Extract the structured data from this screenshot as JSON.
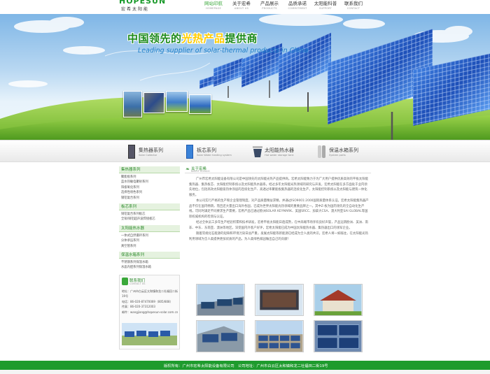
{
  "header": {
    "logo": {
      "brand": "HOPESUN",
      "cn": "宏希太阳能"
    },
    "nav": [
      {
        "cn": "网站印航",
        "en": "HOMEPAGE",
        "active": true
      },
      {
        "cn": "关于宏希",
        "en": "ABOUT US",
        "active": false
      },
      {
        "cn": "产品展示",
        "en": "PRODUCTS",
        "active": false
      },
      {
        "cn": "品质承诺",
        "en": "COMMITMENT",
        "active": false
      },
      {
        "cn": "太阳能科普",
        "en": "SUPPORT",
        "active": false
      },
      {
        "cn": "联系我们",
        "en": "CONTACT",
        "active": false
      }
    ]
  },
  "banner": {
    "slogan_cn_a": "中国领先的",
    "slogan_cn_b": "光热产品",
    "slogan_cn_c": "提供商",
    "slogan_en": "Leading supplier of solar-thermal products in China"
  },
  "categories": [
    {
      "cn": "集热器系列",
      "en": "Solar Collector"
    },
    {
      "cn": "板芯系列",
      "en": "Solar Water heating system"
    },
    {
      "cn": "太阳能热水器",
      "en": "Hot water storage tank"
    },
    {
      "cn": "保温水箱系列",
      "en": "System parts"
    }
  ],
  "sidebar": {
    "groups": [
      {
        "title": "集热器系列",
        "items": [
          "聚能板系列",
          "蓝水热敏电聚射系列",
          "阳极氧化系列",
          "选择性喷色系列",
          "钢铝复合系列"
        ]
      },
      {
        "title": "板芯系列",
        "items": [
          "铜铝复合系列板芯",
          "全铜/铜铝超声波焊接板芯"
        ]
      },
      {
        "title": "太阳能热水器",
        "items": [
          "一体式自然循环系列",
          "分体承压系列",
          "真空管系列"
        ]
      },
      {
        "title": "保温水箱系列",
        "items": [
          "不锈钢系列保温水箱",
          "水晶内胆系列保温水箱"
        ]
      }
    ],
    "contact": {
      "title": "联系我们",
      "title_en": "CONTACT US",
      "lines": [
        "地址：广州市白云区太和镇和龙二社福田二街19号",
        "电话：86-020-87470069（805/808）",
        "传真：86-020-37312003",
        "邮件：wangjiang@hopesun-solar.com.cn"
      ]
    }
  },
  "about": {
    "title": "关于宏希",
    "title_en": "ABOUT HONGXI",
    "paragraphs": [
      "广州市宏希太阳能设备有限公司是中国领先的太阳能光热产品提供商。宏希太阳能致力于为广大用户提供优质高效的平板太阳能集热器、集热板芯、太阳能控制系统以及太阳能热水器系。经过多年太阳能光热领域的研究与开发，宏希太阳能在多方面处于业内领先地位，包括高效太阳能吸热体涂层的连续化生产、高透过率聚能板集热器的连续化生产，太阳能控制系统以及太阳能与建筑一体化服务。",
      "本公司实行严格的生产和企业管理制度，对产品质量精益求精，并通过ISO9001:2000国际质量体系认证。宏希太阳能集热器产品不仅在国内畅销，而且还大量出口海外各国，已成为世界太阳能光热领域的重要品牌之一。其中Z-板为国内领先的全自动化生产线，可同时满足不同要求生产需要，宏希产品已通过欧洲SOLAR KEYMARK、美国SRCC、加拿大CSA、澳大利亚SAI GLOBAL等国际权威机构的检测与认证。",
      "经过全体员工多年生产经验积累和技术研发，宏希平板太阳能日趋成熟，在中高端市场享有良好声誉，产品远销欧洲、美洲、南非、中东、东南亚、澳洲等地区，深受国内外客户好评，宏希太阳能已成为中国太阳能热水器、集热器出口的领军企业。",
      "随着常规化石能源的短缺和环境污染日益严重，发展太阳能等新能源已经成为全人类的共识。宏希人将一如既往，在太阳能光热利用领域为全人类提供更加优质的产品，为人类绿色家园做出自己的贡献！"
    ]
  },
  "footer": {
    "text": "版权所有：广州市宏希太阳能设备有限公司　公司地址：广州市白云区太和镇和龙二社福田二街19号"
  },
  "colors": {
    "brand_green": "#1e9b2d",
    "accent_yellow": "#ffcc00",
    "link_blue": "#1f7fc8"
  }
}
